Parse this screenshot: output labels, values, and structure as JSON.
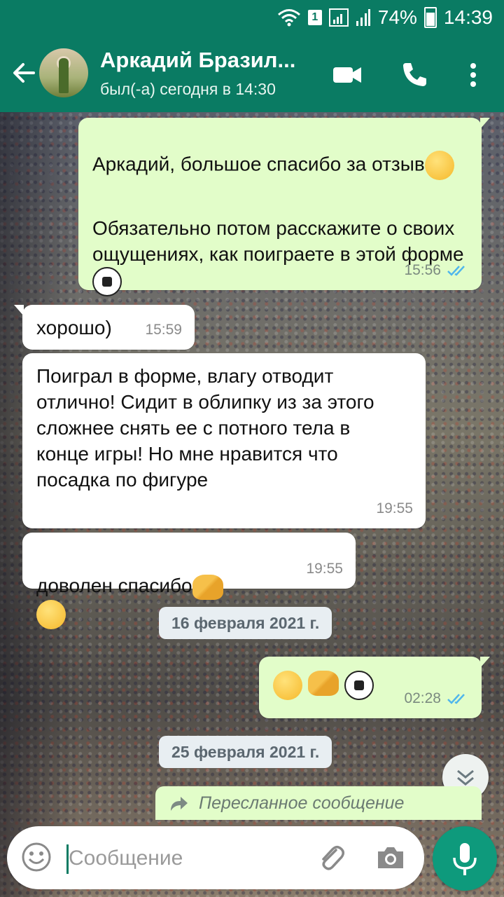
{
  "status_bar": {
    "sim": "1",
    "battery": "74%",
    "time": "14:39"
  },
  "header": {
    "contact_name": "Аркадий Бразил...",
    "last_seen": "был(-а) сегодня в 14:30"
  },
  "messages": [
    {
      "direction": "out",
      "text": "Аркадий, большое спасибо за отзыв",
      "text2": "Обязательно потом расскажите о своих ощущениях, как поиграете в этой форме",
      "time": "15:56",
      "ticks": "read"
    },
    {
      "direction": "in",
      "text": "хорошо)",
      "time": "15:59"
    },
    {
      "direction": "in",
      "text": "Поиграл в форме, влагу отводит отлично! Сидит в облипку из за этого сложнее снять ее с потного тела в конце игры! Но мне нравится что посадка по фигуре",
      "time": "19:55"
    },
    {
      "direction": "in",
      "text": "доволен спасибо",
      "time": "19:55"
    },
    {
      "direction": "out",
      "text": "",
      "time": "02:28",
      "ticks": "read"
    }
  ],
  "date_separators": [
    "16 февраля 2021 г.",
    "25 февраля 2021 г."
  ],
  "forwarded_label": "Пересланное сообщение",
  "composer": {
    "placeholder": "Сообщение"
  },
  "colors": {
    "header": "#0a7b63",
    "outgoing_bubble": "#e2fdc9",
    "incoming_bubble": "#ffffff",
    "read_ticks": "#4fb6ec",
    "mic_button": "#0e9a7c"
  },
  "icons": {
    "back": "arrow-left-icon",
    "video": "video-camera-icon",
    "call": "phone-icon",
    "menu": "more-vertical-icon",
    "emoji": "emoji-icon",
    "attach": "paperclip-icon",
    "camera": "camera-icon",
    "mic": "microphone-icon",
    "forward": "forward-arrow-icon",
    "scroll_down": "chevron-double-down-icon"
  }
}
